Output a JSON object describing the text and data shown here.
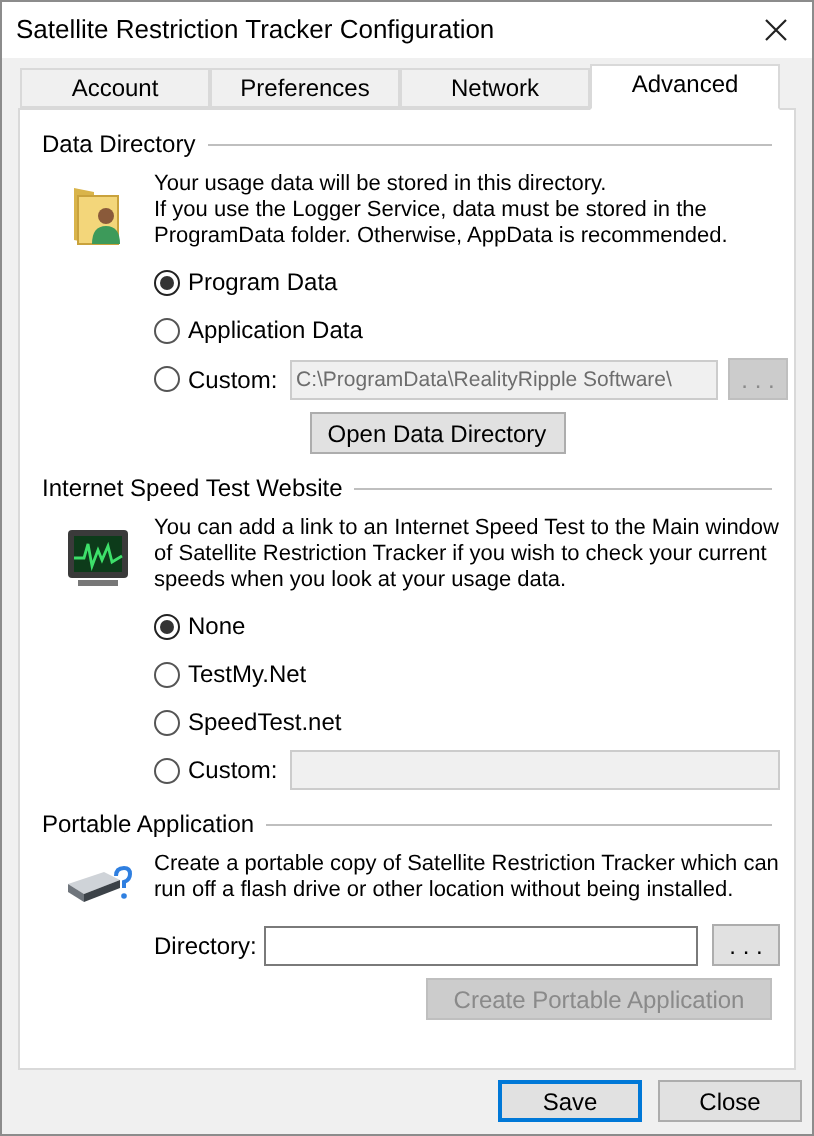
{
  "window": {
    "title": "Satellite Restriction Tracker Configuration"
  },
  "tabs": [
    {
      "label": "Account",
      "selected": false
    },
    {
      "label": "Preferences",
      "selected": false
    },
    {
      "label": "Network",
      "selected": false
    },
    {
      "label": "Advanced",
      "selected": true
    }
  ],
  "sections": [
    {
      "title": "Data Directory",
      "kind": "folder",
      "description": [
        "Your usage data will be stored in this directory.",
        "If you use the Logger Service, data must be stored in the",
        "ProgramData folder. Otherwise, AppData is recommended."
      ],
      "options": [
        {
          "kind": "radio",
          "label": "Program Data",
          "selected": true
        },
        {
          "kind": "radio",
          "label": "Application Data",
          "selected": false
        },
        {
          "kind": "custom",
          "label": "Custom:",
          "selected": false,
          "field": {
            "value": "C:\\ProgramData\\RealityRipple Software\\",
            "disabled": true
          },
          "browse": {
            "label": ". . .",
            "disabled": true
          }
        }
      ],
      "action_button": {
        "label": "Open Data Directory",
        "disabled": false
      }
    },
    {
      "title": "Internet Speed Test Website",
      "kind": "monitor",
      "description": [
        "You can add a link to an Internet Speed Test to the Main window",
        "of Satellite Restriction Tracker if you wish to check your current",
        "speeds when you look at your usage data."
      ],
      "options": [
        {
          "kind": "radio",
          "label": "None",
          "selected": true
        },
        {
          "kind": "radio",
          "label": "TestMy.Net",
          "selected": false
        },
        {
          "kind": "radio",
          "label": "SpeedTest.net",
          "selected": false
        },
        {
          "kind": "custom",
          "label": "Custom:",
          "selected": false,
          "field": {
            "disabled": true
          }
        }
      ]
    },
    {
      "title": "Portable Application",
      "kind": "drive",
      "description": [
        "Create a portable copy of Satellite Restriction Tracker which can",
        "run off a flash drive or other location without being installed."
      ],
      "directory": {
        "label": "Directory:",
        "field": {
          "disabled": false
        },
        "browse": {
          "label": ". . .",
          "disabled": false
        }
      },
      "action_button": {
        "label": "Create Portable Application",
        "disabled": true
      }
    }
  ],
  "footer_buttons": [
    {
      "label": "Save",
      "default": true
    },
    {
      "label": "Close",
      "default": false
    }
  ]
}
